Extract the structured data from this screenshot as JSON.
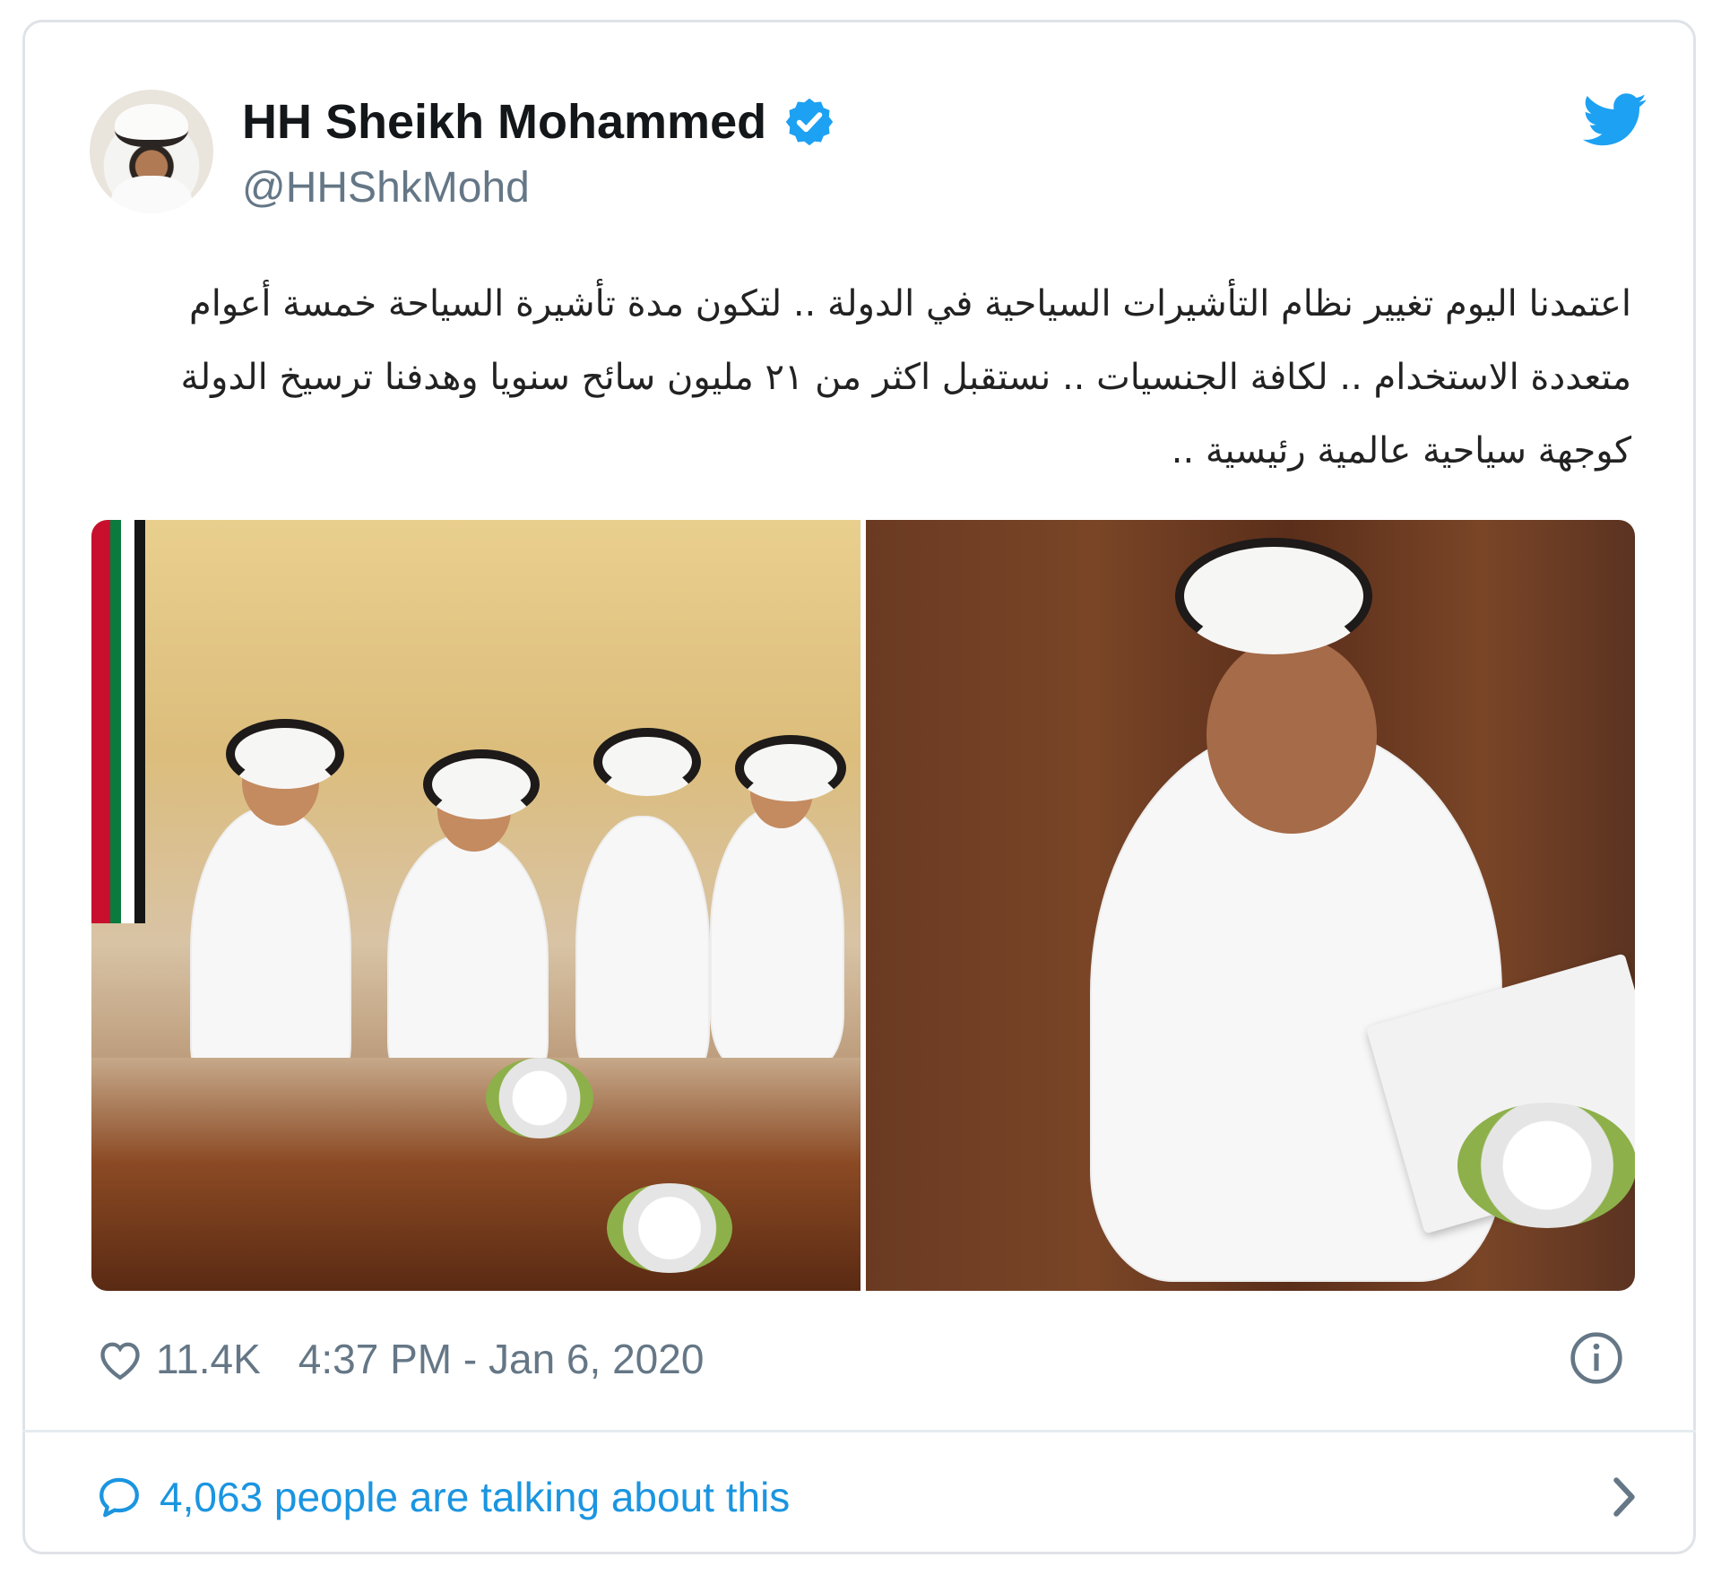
{
  "tweet": {
    "author_name": "HH Sheikh Mohammed",
    "handle": "@HHShkMohd",
    "text": "اعتمدنا اليوم تغيير نظام التأشيرات السياحية في الدولة .. لتكون مدة تأشيرة السياحة خمسة أعوام متعددة الاستخدام .. لكافة الجنسيات .. نستقبل اكثر من ٢١ مليون سائح سنويا وهدفنا ترسيخ الدولة كوجهة سياحية عالمية رئيسية ..",
    "likes": "11.4K",
    "timestamp": "4:37 PM - Jan 6, 2020",
    "talking": "4,063 people are talking about this"
  },
  "colors": {
    "twitter_blue": "#1da1f2",
    "link_blue": "#1b95e0",
    "muted_gray": "#657786",
    "border": "#dfe3e7"
  },
  "icons": {
    "verified": "verified-badge-icon",
    "brand": "twitter-bird-icon",
    "like": "heart-icon",
    "info": "info-icon",
    "reply": "speech-bubble-icon",
    "more": "chevron-right-icon"
  }
}
